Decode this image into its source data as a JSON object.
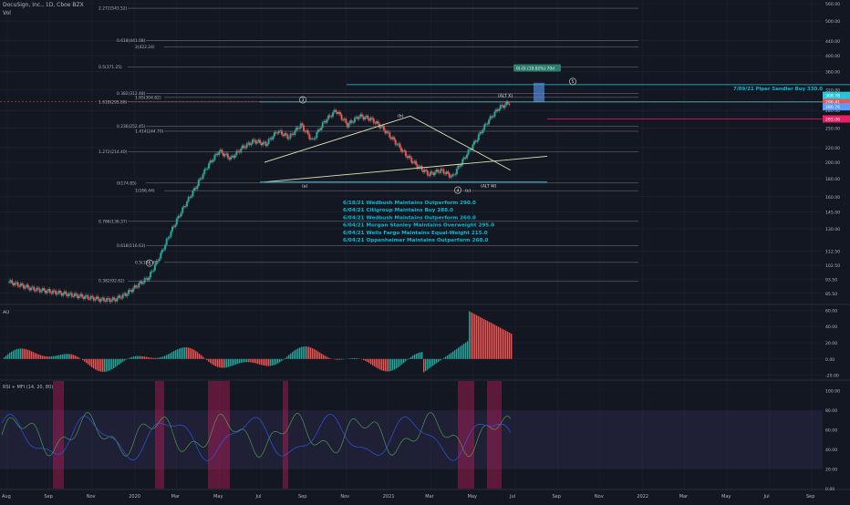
{
  "header": {
    "symbol_line": "DocuSign, Inc., 1D, Cboe BZX",
    "vol_label": "Vol"
  },
  "colors": {
    "background": "#131722",
    "grid": "#1f2431",
    "text": "#b2b5be",
    "up": "#26a69a",
    "down": "#ef5350",
    "fib": "#9598a1",
    "cyan": "#26c6da",
    "annotation": "#00bcd4",
    "ao_up": "#26a69a",
    "ao_down": "#ef5350",
    "rsi_band": "#7e57c2",
    "mfi_highlight": "#e91e63",
    "current_price_bg": "#e91e63"
  },
  "chart_data": [
    {
      "type": "candlestick",
      "panel": "price",
      "ylim": [
        80,
        560
      ],
      "y_scale": "log",
      "price_ticks": [
        "560.00",
        "500.00",
        "440.00",
        "400.00",
        "360.00",
        "320.00",
        "280.00",
        "250.00",
        "220.00",
        "200.00",
        "180.00",
        "160.00",
        "145.00",
        "130.00",
        "112.50",
        "102.50",
        "93.50",
        "85.50"
      ],
      "x_ticks": [
        "Aug",
        "Sep",
        "Nov",
        "2020",
        "Mar",
        "May",
        "Jul",
        "Sep",
        "Nov",
        "2021",
        "Mar",
        "May",
        "Jul",
        "Sep",
        "Nov",
        "2022",
        "Mar",
        "May",
        "Jul",
        "Sep"
      ],
      "price_labels": [
        {
          "text": "296.41",
          "kind": "current"
        },
        {
          "text": "265.06",
          "kind": "line"
        },
        {
          "text": "308.78",
          "kind": "target"
        },
        {
          "text": "286.76",
          "kind": "box"
        }
      ],
      "fib_levels": [
        {
          "label": "2.272(543.52)",
          "value": 543.52
        },
        {
          "label": "0.618(441.08)",
          "value": 441.08
        },
        {
          "label": "2(422.24)",
          "value": 422.24
        },
        {
          "label": "0.5(371.25)",
          "value": 371.25
        },
        {
          "label": "0.382(312.48)",
          "value": 312.48
        },
        {
          "label": "1.65(304.82)",
          "value": 304.82
        },
        {
          "label": "1.618(295.88)",
          "value": 295.88
        },
        {
          "label": "0.236(252.45)",
          "value": 252.45
        },
        {
          "label": "1.414(244.70)",
          "value": 244.7
        },
        {
          "label": "1.272(214.40)",
          "value": 214.4
        },
        {
          "label": "0(174.85)",
          "value": 174.85
        },
        {
          "label": "1(166.44)",
          "value": 166.44
        },
        {
          "label": "0.786(136.37)",
          "value": 136.37
        },
        {
          "label": "0.618(116.63)",
          "value": 116.63
        },
        {
          "label": "0.5(104.49)",
          "value": 104.49
        },
        {
          "label": "0.382(92.62)",
          "value": 92.62
        }
      ],
      "wave_labels": [
        "1",
        "3",
        "(a)",
        "(b)",
        "4",
        "(c)",
        "(ALT X)",
        "(ALT W)",
        "5"
      ],
      "annotations": [
        "6/18/21 Wedbush Maintains Outperform 290.0",
        "6/04/21 Citigroup Maintains Buy 288.0",
        "6/04/21 Wedbush Maintains Outperform 260.0",
        "6/04/21 Morgan Stanley Maintains Overweight 295.0",
        "6/04/21 Wells Fargo Maintains Equal-Weight 215.0",
        "6/04/21 Oppenheimer Maintains Outperform 260.0"
      ],
      "side_annotation": "7/09/21 Piper Sandler Buy 330.0",
      "measure_label": "0(-0) (19.82%) 70d",
      "series": [
        {
          "name": "price",
          "close_path": [
            [
              0,
              92
            ],
            [
              2,
              90
            ],
            [
              4,
              88
            ],
            [
              6,
              87
            ],
            [
              8,
              86
            ],
            [
              10,
              85
            ],
            [
              12,
              84
            ],
            [
              14,
              83
            ],
            [
              16,
              82
            ],
            [
              18,
              82
            ],
            [
              20,
              85
            ],
            [
              22,
              90
            ],
            [
              24,
              95
            ],
            [
              26,
              110
            ],
            [
              28,
              130
            ],
            [
              30,
              150
            ],
            [
              32,
              170
            ],
            [
              34,
              195
            ],
            [
              36,
              215
            ],
            [
              38,
              205
            ],
            [
              40,
              220
            ],
            [
              42,
              230
            ],
            [
              44,
              225
            ],
            [
              46,
              245
            ],
            [
              48,
              235
            ],
            [
              50,
              255
            ],
            [
              52,
              230
            ],
            [
              54,
              260
            ],
            [
              56,
              280
            ],
            [
              58,
              255
            ],
            [
              60,
              270
            ],
            [
              62,
              265
            ],
            [
              64,
              250
            ],
            [
              66,
              230
            ],
            [
              68,
              210
            ],
            [
              70,
              195
            ],
            [
              72,
              185
            ],
            [
              74,
              190
            ],
            [
              76,
              182
            ],
            [
              78,
              205
            ],
            [
              80,
              230
            ],
            [
              82,
              260
            ],
            [
              84,
              285
            ],
            [
              86,
              296
            ]
          ]
        }
      ]
    },
    {
      "type": "bar",
      "panel": "ao",
      "name": "AO",
      "ylim": [
        -25,
        65
      ],
      "ticks": [
        "60.00",
        "40.00",
        "20.00",
        "0.00",
        "-20.00"
      ]
    },
    {
      "type": "line",
      "panel": "rsi_mfi",
      "name": "RSI + MFI (14, 20, 80)",
      "ylim": [
        0,
        110
      ],
      "ticks": [
        "100.00",
        "80.00",
        "60.00",
        "40.00",
        "20.00",
        "0.00"
      ]
    }
  ]
}
